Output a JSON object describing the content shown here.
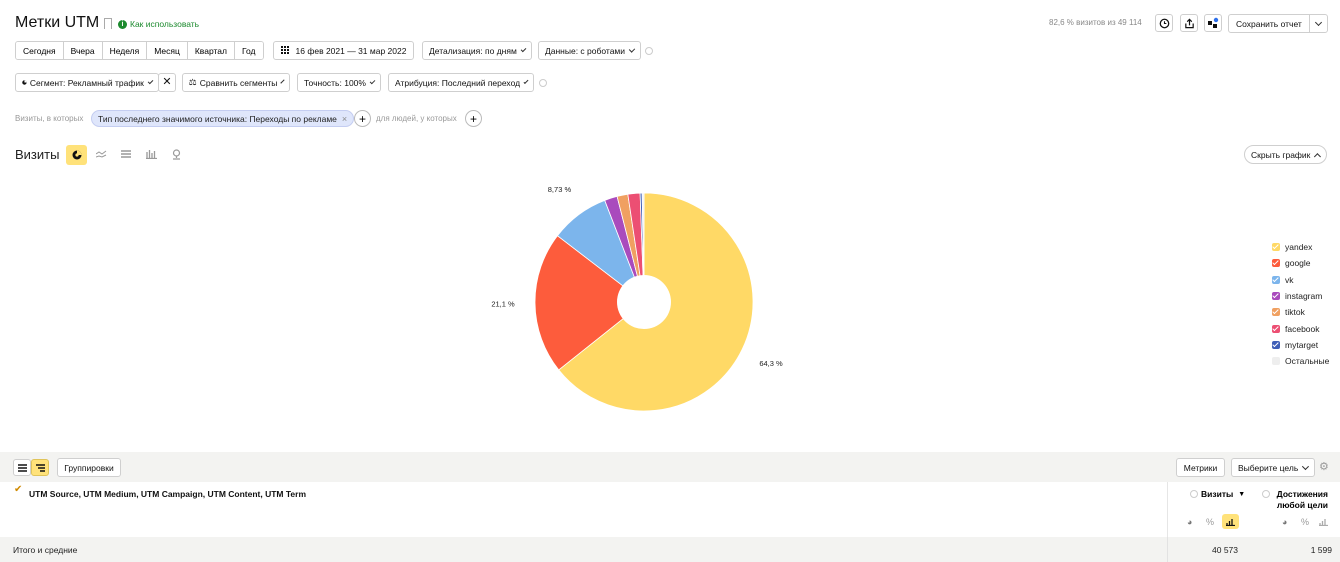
{
  "header": {
    "title": "Метки UTM",
    "how_to_use": "Как использовать",
    "sample_info": "82,6 % визитов из 49 114",
    "save_report": "Сохранить отчет"
  },
  "period_tabs": [
    "Сегодня",
    "Вчера",
    "Неделя",
    "Месяц",
    "Квартал",
    "Год"
  ],
  "date_range": "16 фев 2021 — 31 мар 2022",
  "detail": "Детализация: по дням",
  "data_mode": "Данные: с роботами",
  "segment": "Сегмент: Рекламный трафик",
  "compare": "Сравнить сегменты",
  "accuracy": "Точность: 100%",
  "attribution": "Атрибуция: Последний переход",
  "filter": {
    "prefix": "Визиты, в которых",
    "chip": "Тип последнего значимого источника: Переходы по рекламе",
    "people": "для людей, у которых"
  },
  "chart_section": {
    "title": "Визиты",
    "hide_chart": "Скрыть график"
  },
  "chart_data": {
    "type": "pie",
    "labels": [
      "yandex",
      "google",
      "vk",
      "instagram",
      "tiktok",
      "facebook",
      "mytarget",
      "Остальные"
    ],
    "values": [
      64.3,
      21.1,
      8.73,
      1.9,
      1.6,
      1.8,
      0.3,
      0.27
    ],
    "colors": [
      "#ffd966",
      "#fd5c3c",
      "#7cb5ec",
      "#a94bbd",
      "#f0a061",
      "#ec4f73",
      "#3f5fb7",
      "#eeeeee"
    ],
    "data_labels": [
      "64,3 %",
      "21,1 %",
      "8,73 %"
    ]
  },
  "table": {
    "groupings": "Группировки",
    "metrics": "Метрики",
    "choose_goal": "Выберите цель",
    "dimension_header": "UTM Source, UTM Medium, UTM Campaign, UTM Content, UTM Term",
    "col_visits": "Визиты",
    "col_goal": "Достижения любой цели",
    "totals_label": "Итого и средние",
    "total_visits": "40 573",
    "total_goal": "1 599"
  }
}
